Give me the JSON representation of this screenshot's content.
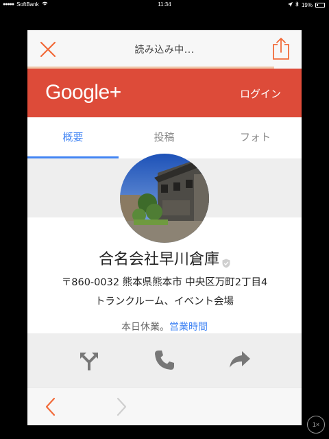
{
  "status_bar": {
    "carrier": "SoftBank",
    "time": "11:34",
    "battery_percent": "19%"
  },
  "webview": {
    "loading_title": "読み込み中...",
    "progress": 0.9
  },
  "google_header": {
    "logo_text": "Google+",
    "login_label": "ログイン",
    "brand_color": "#dd4b39"
  },
  "tabs": [
    {
      "label": "概要",
      "active": true
    },
    {
      "label": "投稿",
      "active": false
    },
    {
      "label": "フォト",
      "active": false
    }
  ],
  "profile": {
    "name": "合名会社早川倉庫",
    "address": "〒860-0032 熊本県熊本市 中央区万町2丁目4",
    "category": "トランクルーム、イベント会場",
    "hours_status": "本日休業。",
    "hours_link": "営業時間"
  },
  "actions": [
    "directions-icon",
    "phone-icon",
    "share-arrow-icon"
  ],
  "zoom_label": "1×",
  "colors": {
    "accent": "#4285f4",
    "nav_orange": "#f26b3a"
  }
}
